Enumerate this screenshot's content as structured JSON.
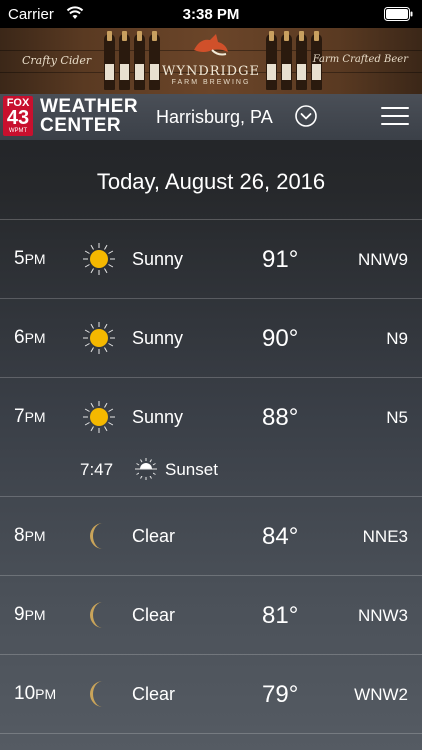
{
  "status_bar": {
    "carrier": "Carrier",
    "time": "3:38 PM"
  },
  "ad": {
    "left_text": "Crafty Cider",
    "brand": "WYNDRIDGE",
    "brand_sub": "FARM BREWING",
    "right_text": "Farm Crafted Beer"
  },
  "header": {
    "logo_fox": "FOX",
    "logo_number": "43",
    "logo_call": "WPMT",
    "logo_line1": "WEATHER",
    "logo_line2": "CENTER",
    "city": "Harrisburg, PA"
  },
  "date": "Today, August 26, 2016",
  "hours": [
    {
      "hour": "5",
      "ampm": "PM",
      "icon": "sun-icon",
      "condition": "Sunny",
      "temp": "91°",
      "wind": "NNW9"
    },
    {
      "hour": "6",
      "ampm": "PM",
      "icon": "sun-icon",
      "condition": "Sunny",
      "temp": "90°",
      "wind": "N9"
    },
    {
      "hour": "7",
      "ampm": "PM",
      "icon": "sun-icon",
      "condition": "Sunny",
      "temp": "88°",
      "wind": "N5",
      "sunset": {
        "time": "7:47",
        "label": "Sunset"
      }
    },
    {
      "hour": "8",
      "ampm": "PM",
      "icon": "moon-icon",
      "condition": "Clear",
      "temp": "84°",
      "wind": "NNE3"
    },
    {
      "hour": "9",
      "ampm": "PM",
      "icon": "moon-icon",
      "condition": "Clear",
      "temp": "81°",
      "wind": "NNW3"
    },
    {
      "hour": "10",
      "ampm": "PM",
      "icon": "moon-icon",
      "condition": "Clear",
      "temp": "79°",
      "wind": "WNW2"
    }
  ],
  "colors": {
    "sun": "#f5b800",
    "moon": "#c9a45a",
    "logo_red": "#c8102e"
  }
}
